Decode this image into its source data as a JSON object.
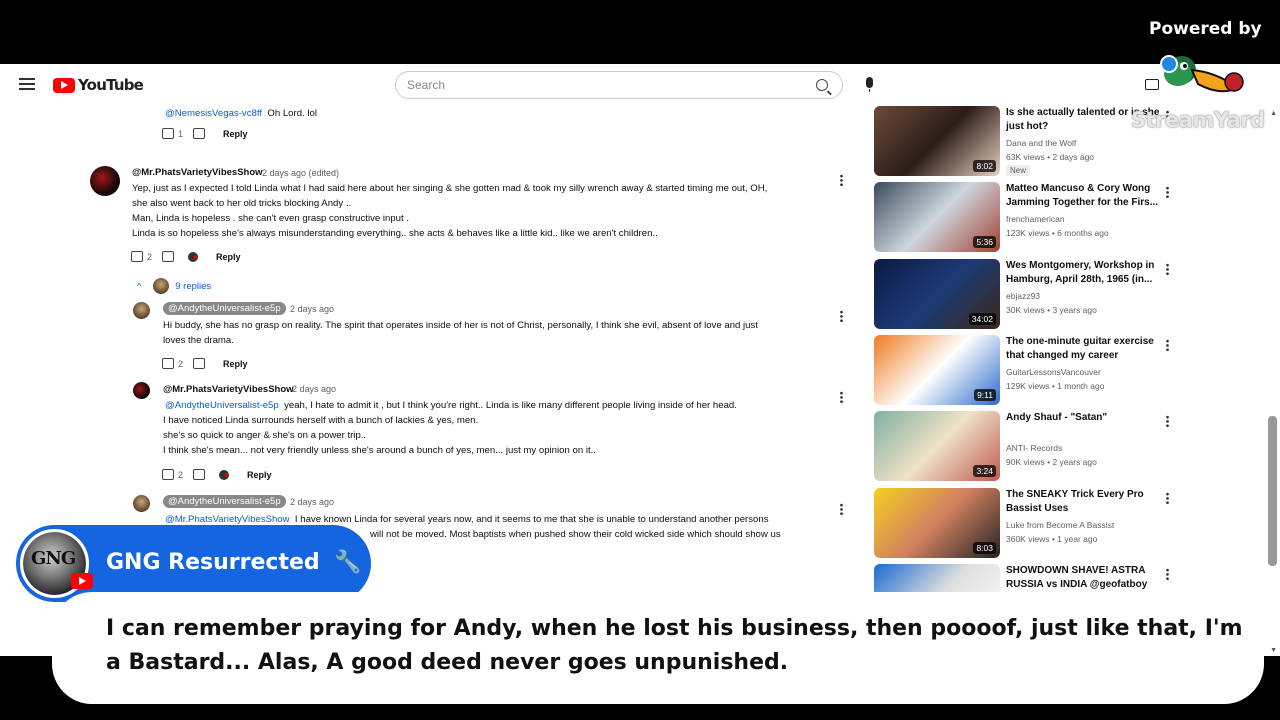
{
  "overlay": {
    "powered_by": "Powered by",
    "streamyard_text": "StreamYard",
    "channel_name": "GNG Resurrected",
    "channel_avatar_text": "GNG",
    "caption": "I can remember praying for Andy, when he lost his business, then poooof, just like that, I'm a Bastard... Alas, A good deed never goes unpunished."
  },
  "header": {
    "logo_text": "YouTube",
    "search_placeholder": "Search"
  },
  "comments": {
    "top_reply": {
      "mention": "@NemesisVegas-vc8ff",
      "text": "Oh Lord. lol",
      "likes": "1",
      "reply_label": "Reply"
    },
    "main": {
      "author": "@Mr.PhatsVarietyVibesShow",
      "time": "2 days ago (edited)",
      "lines": [
        "Yep, just as I expected I told Linda what I had said here about her singing & she gotten mad & took my silly wrench away & started timing me out, OH,",
        "she also went back to her old tricks blocking Andy ..",
        "Man, Linda is hopeless . she can't even grasp constructive input .",
        "Linda is so hopeless she's always misunderstanding everything.. she acts & behaves like a little kid.. like we aren't children.."
      ],
      "likes": "2",
      "reply_label": "Reply",
      "replies_count": "9 replies"
    },
    "reply1": {
      "author": "@AndytheUniversalist-e5p",
      "time": "2 days ago",
      "lines": [
        "Hi buddy, she has no grasp on reality. The spirit that operates inside of her is not of Christ, personally, I think she evil, absent of love and just",
        "loves the drama."
      ],
      "likes": "2",
      "reply_label": "Reply"
    },
    "reply2": {
      "author": "@Mr.PhatsVarietyVibesShow",
      "time": "2 days ago",
      "mention": "@AndytheUniversalist-e5p",
      "first_text": "yeah, I hate to admit it , but I think you're right.. Linda is like many different people living inside of her head.",
      "lines": [
        "I have noticed Linda surrounds herself with a bunch of lackies & yes, men.",
        "she's so quick to anger & she's on a power trip..",
        "I think she's mean... not very friendly unless she's around a bunch of yes, men... just my opinion on it.."
      ],
      "likes": "2",
      "reply_label": "Reply"
    },
    "reply3": {
      "author": "@AndytheUniversalist-e5p",
      "time": "2 days ago",
      "mention": "@Mr.PhatsVarietyVibesShow",
      "first_text": "I have known Linda for several years now, and it seems to me that she is unable to understand another persons",
      "second_text": "will not be moved. Most baptists when pushed show their cold wicked side which should show us"
    }
  },
  "sidebar": {
    "videos": [
      {
        "title": "Is she actually talented or is she just hot?",
        "channel": "Dana and the Wolf",
        "meta": "63K views • 2 days ago",
        "badge": "New",
        "duration": "8:02",
        "thumb_colors": [
          "#6e4a3a",
          "#e8d2c0",
          "#2b1d18"
        ]
      },
      {
        "title": "Matteo Mancuso & Cory Wong Jamming Together for the Firs...",
        "channel": "frenchamerican",
        "meta": "123K views • 6 months ago",
        "duration": "5:36",
        "thumb_colors": [
          "#3a4a5a",
          "#a04030",
          "#cfd6de"
        ]
      },
      {
        "title": "Wes Montgomery, Workshop in Hamburg, April 28th, 1965 (in...",
        "channel": "ebjazz93",
        "meta": "30K views • 3 years ago",
        "duration": "34:02",
        "thumb_colors": [
          "#0b1a40",
          "#3b2818",
          "#1c3a78"
        ]
      },
      {
        "title": "The one-minute guitar exercise that changed my career",
        "channel": "GuitarLessonsVancouver",
        "meta": "129K views • 1 month ago",
        "duration": "9:11",
        "thumb_colors": [
          "#f07a20",
          "#2a6acc",
          "#ffffff"
        ]
      },
      {
        "title": "Andy Shauf - \"Satan\"",
        "channel": "ANTI- Records",
        "meta": "90K views • 2 years ago",
        "duration": "3:24",
        "thumb_colors": [
          "#7fb0a0",
          "#c05a50",
          "#f0e2c8"
        ]
      },
      {
        "title": "The SNEAKY Trick Every Pro Bassist Uses",
        "channel": "Luke from Become A Bassist",
        "meta": "360K views • 1 year ago",
        "duration": "8:03",
        "thumb_colors": [
          "#f5d020",
          "#222222",
          "#d08060"
        ]
      },
      {
        "title": "SHOWDOWN SHAVE! ASTRA RUSSIA vs INDIA @geofatboy",
        "channel": "",
        "meta": "",
        "duration": "",
        "thumb_colors": [
          "#1a6ad0",
          "#ffffff",
          "#e0e0e0"
        ]
      }
    ]
  },
  "colors": {
    "youtube_red": "#ff0000",
    "channel_badge": "#1565e0",
    "mention": "#065fd4"
  }
}
